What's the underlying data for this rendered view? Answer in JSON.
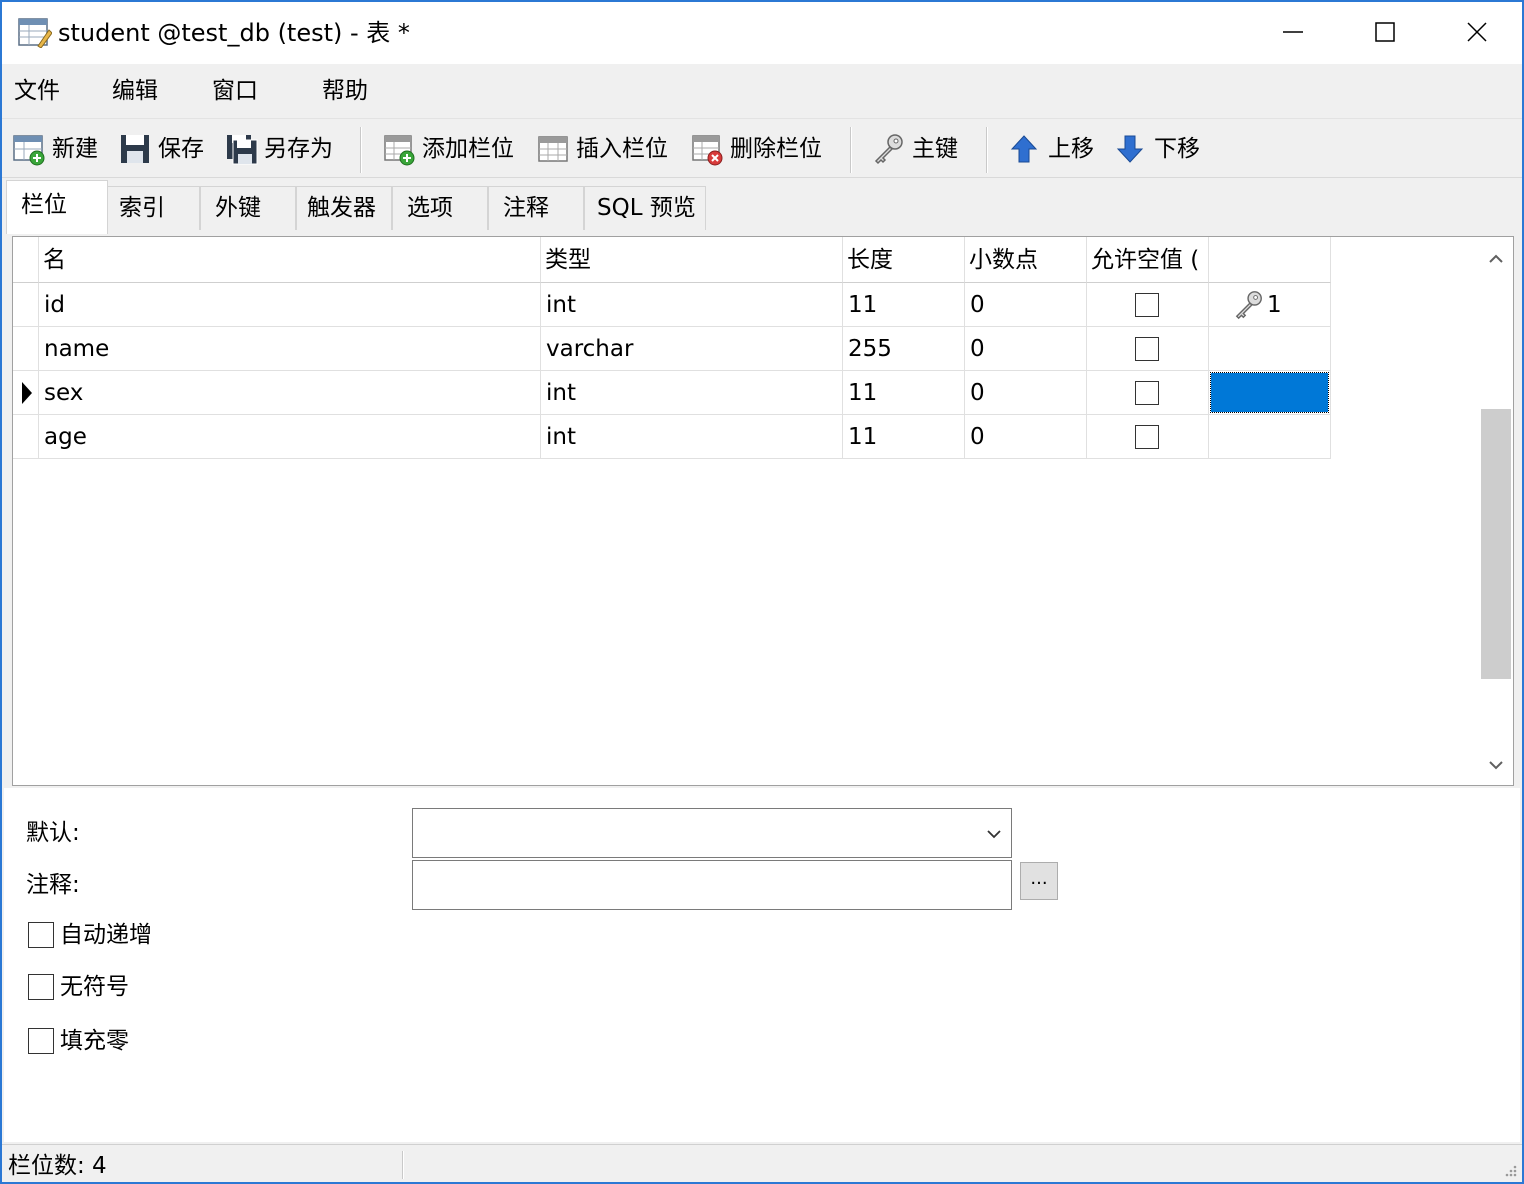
{
  "window": {
    "title": "student @test_db (test) - 表 *",
    "minimize_icon": "minimize-icon",
    "maximize_icon": "maximize-icon",
    "close_icon": "close-icon"
  },
  "menu": [
    "文件",
    "编辑",
    "窗口",
    "帮助"
  ],
  "toolbar": {
    "new": "新建",
    "save": "保存",
    "save_as": "另存为",
    "add_column": "添加栏位",
    "insert_column": "插入栏位",
    "delete_column": "删除栏位",
    "primary_key": "主键",
    "move_up": "上移",
    "move_down": "下移"
  },
  "tabs": [
    "栏位",
    "索引",
    "外键",
    "触发器",
    "选项",
    "注释",
    "SQL 预览"
  ],
  "grid": {
    "columns": [
      "名",
      "类型",
      "长度",
      "小数点",
      "允许空值 ("
    ],
    "rows": [
      {
        "name": "id",
        "type": "int",
        "length": "11",
        "decimals": "0",
        "nullable": false,
        "key": "1",
        "selected": false
      },
      {
        "name": "name",
        "type": "varchar",
        "length": "255",
        "decimals": "0",
        "nullable": false,
        "key": "",
        "selected": false
      },
      {
        "name": "sex",
        "type": "int",
        "length": "11",
        "decimals": "0",
        "nullable": false,
        "key": "",
        "selected": true
      },
      {
        "name": "age",
        "type": "int",
        "length": "11",
        "decimals": "0",
        "nullable": false,
        "key": "",
        "selected": false
      }
    ]
  },
  "properties": {
    "default_label": "默认:",
    "default_value": "",
    "comment_label": "注释:",
    "comment_value": "",
    "ellipsis": "...",
    "auto_increment": {
      "label": "自动递增",
      "checked": false
    },
    "unsigned": {
      "label": "无符号",
      "checked": false
    },
    "zerofill": {
      "label": "填充零",
      "checked": false
    }
  },
  "status": {
    "column_count": "栏位数: 4"
  },
  "colors": {
    "accent": "#0078d7",
    "window_border": "#2b78d4"
  }
}
